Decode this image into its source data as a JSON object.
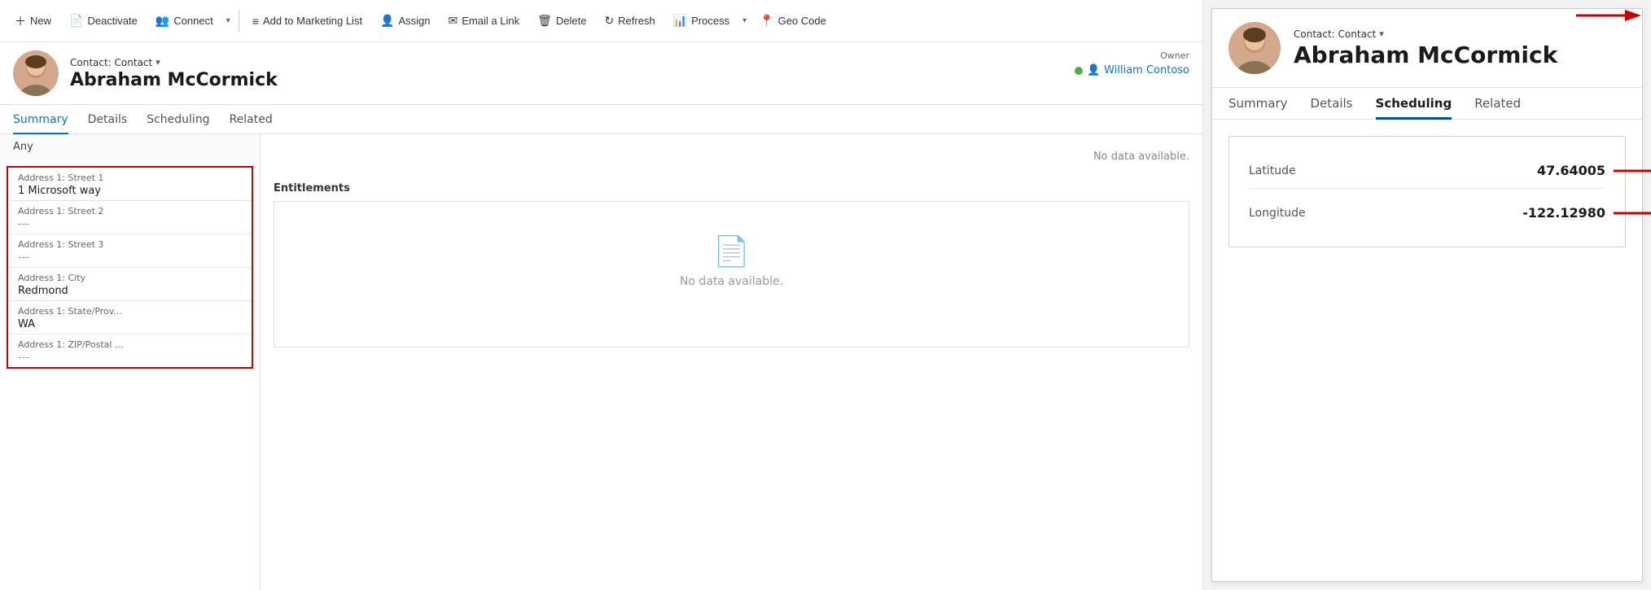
{
  "toolbar": {
    "new_label": "New",
    "deactivate_label": "Deactivate",
    "connect_label": "Connect",
    "marketing_label": "Add to Marketing List",
    "assign_label": "Assign",
    "email_label": "Email a Link",
    "delete_label": "Delete",
    "refresh_label": "Refresh",
    "process_label": "Process",
    "geocode_label": "Geo Code"
  },
  "record": {
    "type": "Contact: Contact",
    "name": "Abraham McCormick",
    "owner_label": "Owner",
    "owner_name": "William Contoso"
  },
  "tabs": {
    "summary": "Summary",
    "details": "Details",
    "scheduling": "Scheduling",
    "related": "Related"
  },
  "address": {
    "group_label": "Any",
    "street1_label": "Address 1: Street 1",
    "street1_value": "1 Microsoft way",
    "street2_label": "Address 1: Street 2",
    "street2_value": "---",
    "street3_label": "Address 1: Street 3",
    "street3_value": "---",
    "city_label": "Address 1: City",
    "city_value": "Redmond",
    "state_label": "Address 1: State/Prov...",
    "state_value": "WA",
    "zip_label": "Address 1: ZIP/Postal ...",
    "zip_value": "---"
  },
  "right_panel": {
    "type": "Contact: Contact",
    "name": "Abraham McCormick",
    "tabs": {
      "summary": "Summary",
      "details": "Details",
      "scheduling": "Scheduling",
      "related": "Related"
    },
    "latitude_label": "Latitude",
    "latitude_value": "47.64005",
    "longitude_label": "Longitude",
    "longitude_value": "-122.12980"
  },
  "entitlements": {
    "label": "Entitlements",
    "empty_text": "No data available."
  },
  "no_data": "No data available."
}
